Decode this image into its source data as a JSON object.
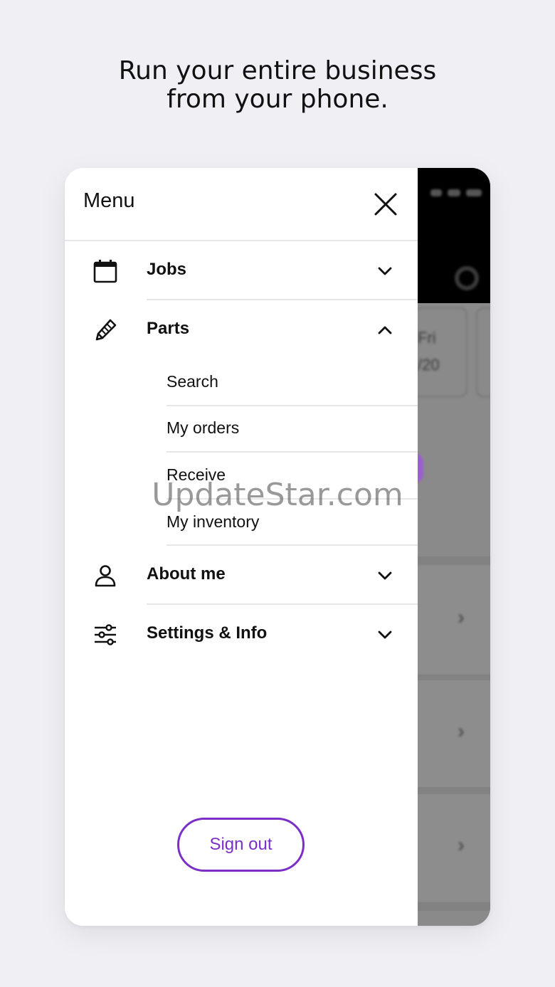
{
  "headline": {
    "line1": "Run your entire business",
    "line2": "from your phone."
  },
  "drawer": {
    "title": "Menu",
    "close_icon": "close-icon",
    "items": [
      {
        "label": "Jobs",
        "icon": "calendar-icon",
        "expanded": false
      },
      {
        "label": "Parts",
        "icon": "pencil-icon",
        "expanded": true,
        "subitems": [
          "Search",
          "My orders",
          "Receive",
          "My inventory"
        ]
      },
      {
        "label": "About me",
        "icon": "person-icon",
        "expanded": false
      },
      {
        "label": "Settings & Info",
        "icon": "sliders-icon",
        "expanded": false
      }
    ],
    "sign_out_label": "Sign out"
  },
  "background_app": {
    "day": "Fri",
    "date": "/20"
  },
  "watermark": "UpdateStar.com",
  "colors": {
    "accent": "#7b2fc8",
    "page_background": "#efeff4",
    "overlay": "#8a8a8a"
  }
}
